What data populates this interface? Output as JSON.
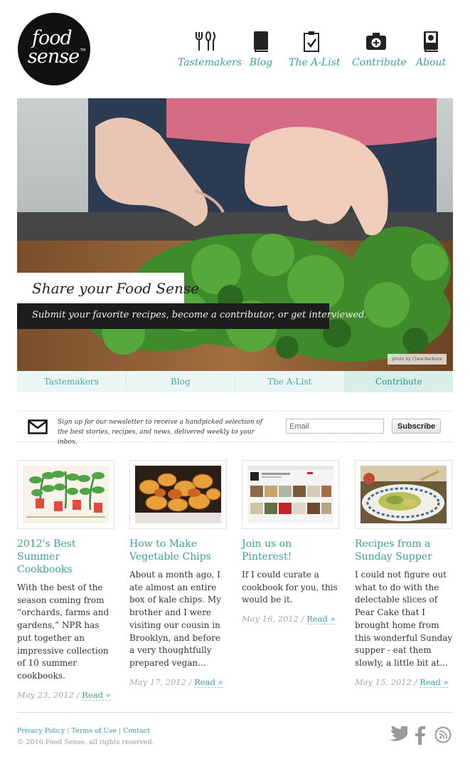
{
  "logo": {
    "line1": "food",
    "line2": "sense",
    "tm": "TM"
  },
  "nav": [
    {
      "label": "Tastemakers",
      "icon": "utensils-icon"
    },
    {
      "label": "Blog",
      "icon": "book-icon"
    },
    {
      "label": "The A-List",
      "icon": "clipboard-check-icon"
    },
    {
      "label": "Contribute",
      "icon": "camera-plus-icon"
    },
    {
      "label": "About",
      "icon": "notebook-icon"
    }
  ],
  "hero": {
    "title": "Share your Food Sense",
    "subtitle": "Submit your favorite recipes, become a contributor, or get interviewed.",
    "credit": "photo by Clare Barboza"
  },
  "subnav": [
    "Tastemakers",
    "Blog",
    "The A-List",
    "Contribute"
  ],
  "newsletter": {
    "text": "Sign up for our newsletter to receive a handpicked selection of the best stories, recipes, and news, delivered weekly to your inbox.",
    "placeholder": "Email",
    "button": "Subscribe"
  },
  "cards": [
    {
      "title": "2012's Best Summer Cookbooks",
      "excerpt": "With the best of the season coming from “orchards, farms and gardens,” NPR has put together an impressive collection of 10 summer cookbooks.",
      "date": "May 23, 2012 /",
      "read": "Read »"
    },
    {
      "title": "How to Make Vegetable Chips",
      "excerpt": "About a month ago, I ate almost an entire box of kale chips. My brother and I were visiting our cousin in Brooklyn, and before a very thoughtfully prepared vegan...",
      "date": "May 17, 2012 /",
      "read": "Read »"
    },
    {
      "title": "Join us on Pinterest!",
      "excerpt": "If I could curate a cookbook for you, this would be it.",
      "date": "May 16, 2012 /",
      "read": "Read »"
    },
    {
      "title": "Recipes from a Sunday Supper",
      "excerpt": "I could not figure out what to do with the delectable slices of Pear Cake that I brought home from this wonderful Sunday supper - eat them slowly, a little bit at...",
      "date": "May 15, 2012 /",
      "read": "Read »"
    }
  ],
  "footer": {
    "privacy": "Privacy Policy",
    "terms": "Terms of Use",
    "contact": "Contact",
    "sep": "|",
    "copyright": "© 2016 Food Sense, all rights reserved."
  },
  "social": [
    "twitter-icon",
    "facebook-icon",
    "rss-icon"
  ],
  "colors": {
    "accent": "#3aa394",
    "tab_bg": "#eaf6f3",
    "dark": "#1d1d1d"
  }
}
